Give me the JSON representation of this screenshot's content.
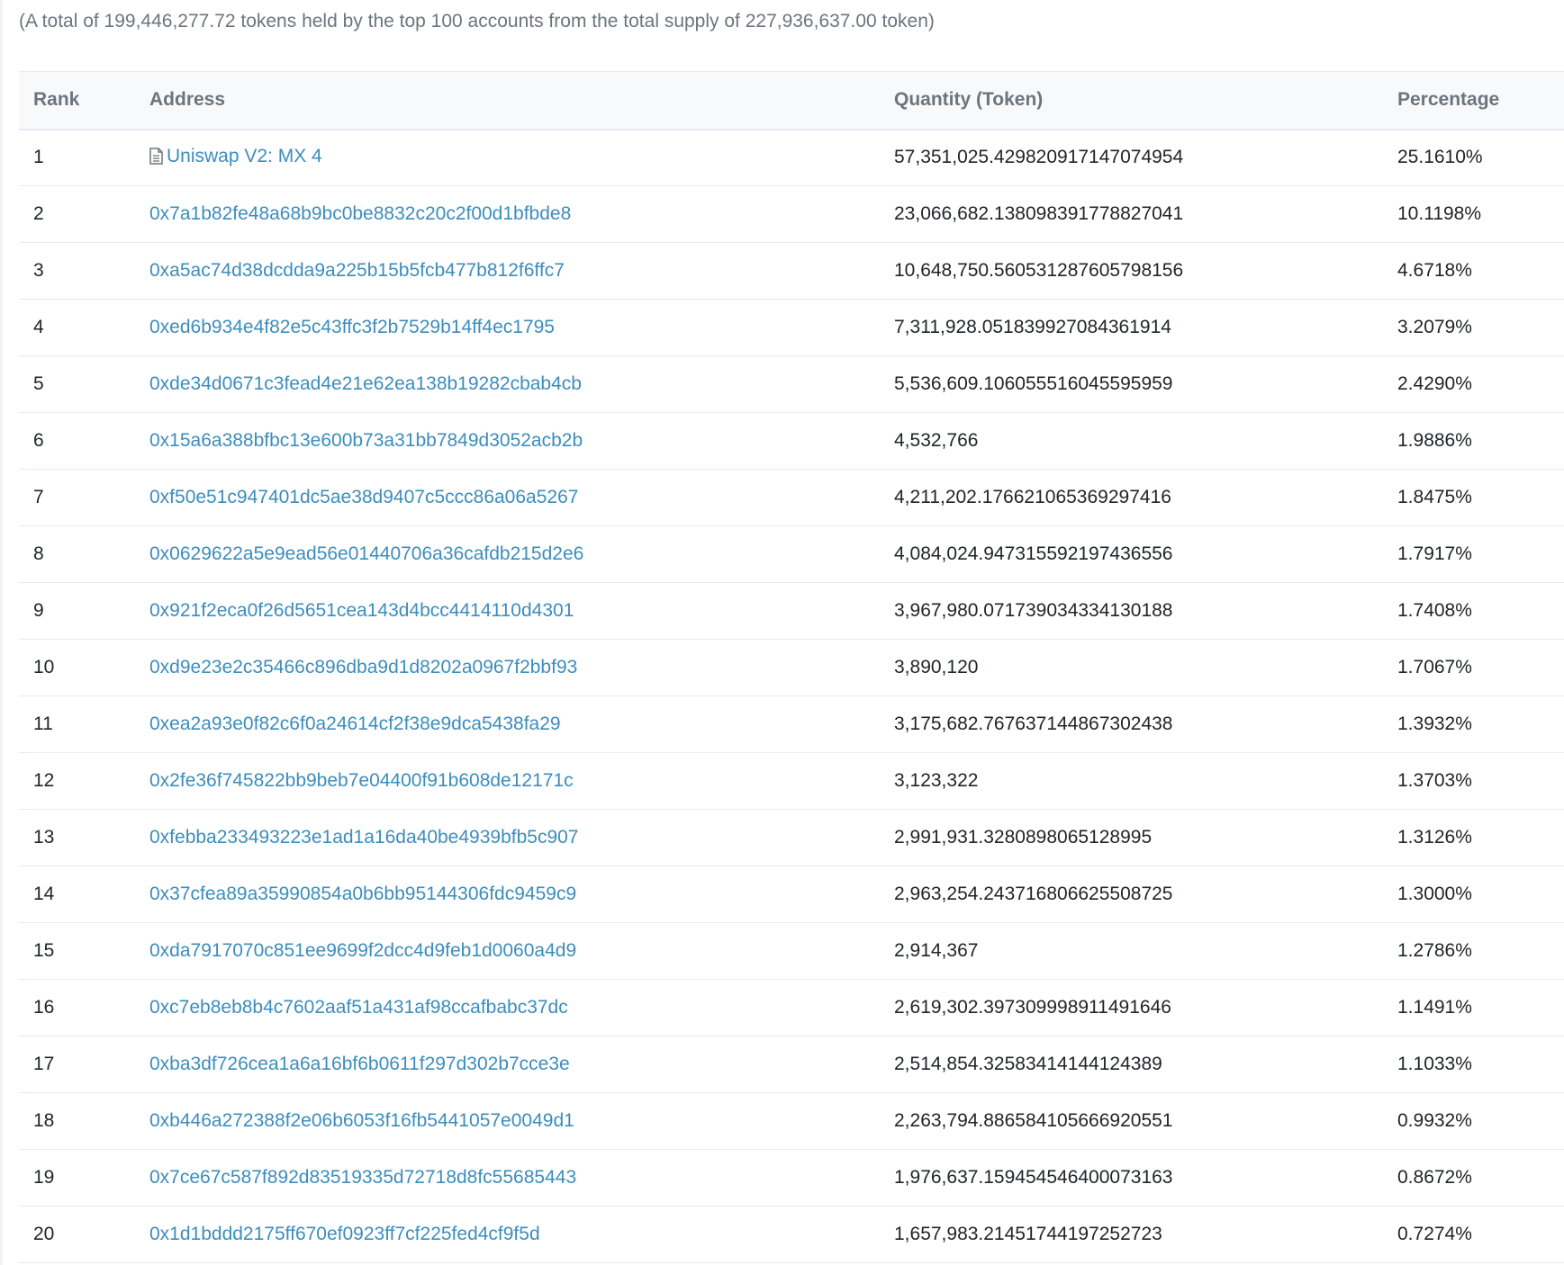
{
  "summary": "(A total of 199,446,277.72 tokens held by the top 100 accounts from the total supply of 227,936,637.00 token)",
  "columns": {
    "rank": "Rank",
    "address": "Address",
    "quantity": "Quantity (Token)",
    "percentage": "Percentage"
  },
  "colors": {
    "link": "#3c8dbc",
    "header_text": "#6c757d",
    "row_border": "#e7eaf3"
  },
  "rows": [
    {
      "rank": "1",
      "address": "Uniswap V2: MX 4",
      "is_contract": true,
      "contract_icon": "file-text-icon",
      "quantity": "57,351,025.429820917147074954",
      "percentage": "25.1610%"
    },
    {
      "rank": "2",
      "address": "0x7a1b82fe48a68b9bc0be8832c20c2f00d1bfbde8",
      "quantity": "23,066,682.138098391778827041",
      "percentage": "10.1198%"
    },
    {
      "rank": "3",
      "address": "0xa5ac74d38dcdda9a225b15b5fcb477b812f6ffc7",
      "quantity": "10,648,750.560531287605798156",
      "percentage": "4.6718%"
    },
    {
      "rank": "4",
      "address": "0xed6b934e4f82e5c43ffc3f2b7529b14ff4ec1795",
      "quantity": "7,311,928.051839927084361914",
      "percentage": "3.2079%"
    },
    {
      "rank": "5",
      "address": "0xde34d0671c3fead4e21e62ea138b19282cbab4cb",
      "quantity": "5,536,609.106055516045595959",
      "percentage": "2.4290%"
    },
    {
      "rank": "6",
      "address": "0x15a6a388bfbc13e600b73a31bb7849d3052acb2b",
      "quantity": "4,532,766",
      "percentage": "1.9886%"
    },
    {
      "rank": "7",
      "address": "0xf50e51c947401dc5ae38d9407c5ccc86a06a5267",
      "quantity": "4,211,202.176621065369297416",
      "percentage": "1.8475%"
    },
    {
      "rank": "8",
      "address": "0x0629622a5e9ead56e01440706a36cafdb215d2e6",
      "quantity": "4,084,024.947315592197436556",
      "percentage": "1.7917%"
    },
    {
      "rank": "9",
      "address": "0x921f2eca0f26d5651cea143d4bcc4414110d4301",
      "quantity": "3,967,980.071739034334130188",
      "percentage": "1.7408%"
    },
    {
      "rank": "10",
      "address": "0xd9e23e2c35466c896dba9d1d8202a0967f2bbf93",
      "quantity": "3,890,120",
      "percentage": "1.7067%"
    },
    {
      "rank": "11",
      "address": "0xea2a93e0f82c6f0a24614cf2f38e9dca5438fa29",
      "quantity": "3,175,682.767637144867302438",
      "percentage": "1.3932%"
    },
    {
      "rank": "12",
      "address": "0x2fe36f745822bb9beb7e04400f91b608de12171c",
      "quantity": "3,123,322",
      "percentage": "1.3703%"
    },
    {
      "rank": "13",
      "address": "0xfebba233493223e1ad1a16da40be4939bfb5c907",
      "quantity": "2,991,931.3280898065128995",
      "percentage": "1.3126%"
    },
    {
      "rank": "14",
      "address": "0x37cfea89a35990854a0b6bb95144306fdc9459c9",
      "quantity": "2,963,254.243716806625508725",
      "percentage": "1.3000%"
    },
    {
      "rank": "15",
      "address": "0xda7917070c851ee9699f2dcc4d9feb1d0060a4d9",
      "quantity": "2,914,367",
      "percentage": "1.2786%"
    },
    {
      "rank": "16",
      "address": "0xc7eb8eb8b4c7602aaf51a431af98ccafbabc37dc",
      "quantity": "2,619,302.397309998911491646",
      "percentage": "1.1491%"
    },
    {
      "rank": "17",
      "address": "0xba3df726cea1a6a16bf6b0611f297d302b7cce3e",
      "quantity": "2,514,854.32583414144124389",
      "percentage": "1.1033%"
    },
    {
      "rank": "18",
      "address": "0xb446a272388f2e06b6053f16fb5441057e0049d1",
      "quantity": "2,263,794.886584105666920551",
      "percentage": "0.9932%"
    },
    {
      "rank": "19",
      "address": "0x7ce67c587f892d83519335d72718d8fc55685443",
      "quantity": "1,976,637.159454546400073163",
      "percentage": "0.8672%"
    },
    {
      "rank": "20",
      "address": "0x1d1bddd2175ff670ef0923ff7cf225fed4cf9f5d",
      "quantity": "1,657,983.21451744197252723",
      "percentage": "0.7274%"
    }
  ]
}
